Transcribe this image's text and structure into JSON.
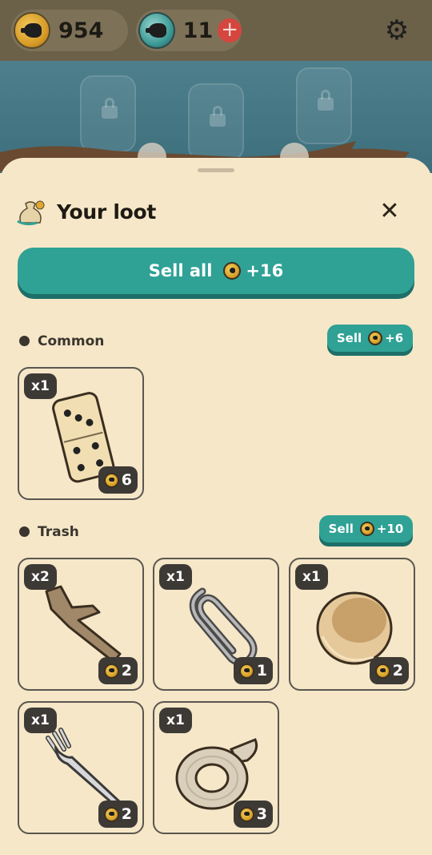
{
  "header": {
    "coins": "954",
    "gems": "11",
    "add_gems_label": "+"
  },
  "sheet": {
    "title": "Your loot",
    "close_label": "✕",
    "sell_all": {
      "label": "Sell all",
      "amount": "+16"
    }
  },
  "sections": [
    {
      "name": "Common",
      "sell_label": "Sell",
      "sell_amount": "+6",
      "items": [
        {
          "name": "domino",
          "qty": "x1",
          "price": "6"
        }
      ]
    },
    {
      "name": "Trash",
      "sell_label": "Sell",
      "sell_amount": "+10",
      "items": [
        {
          "name": "stick",
          "qty": "x2",
          "price": "2"
        },
        {
          "name": "paperclip",
          "qty": "x1",
          "price": "1"
        },
        {
          "name": "wooden-bowl",
          "qty": "x1",
          "price": "2"
        },
        {
          "name": "fork",
          "qty": "x1",
          "price": "2"
        },
        {
          "name": "tape-roll",
          "qty": "x1",
          "price": "3"
        }
      ]
    }
  ],
  "colors": {
    "accent": "#2fa195",
    "background": "#f6e7c8",
    "badge": "#3d3a36"
  }
}
